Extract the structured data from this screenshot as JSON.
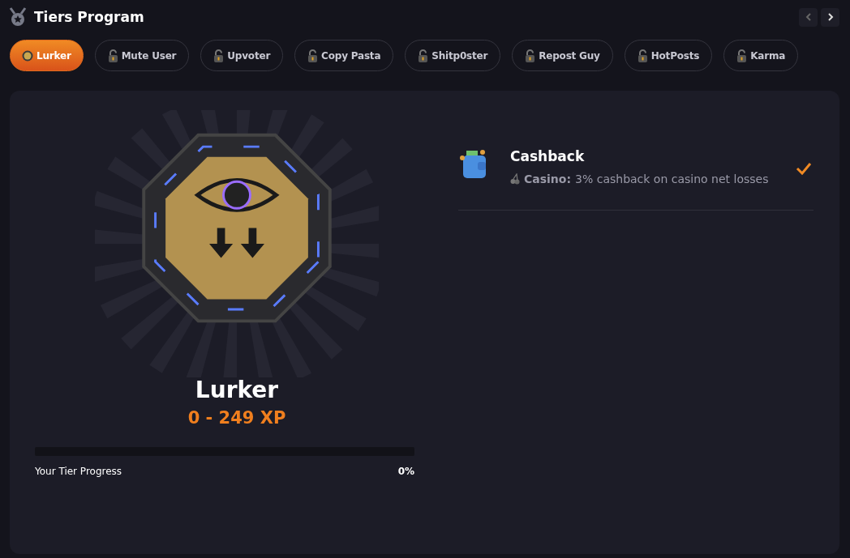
{
  "header": {
    "title": "Tiers Program"
  },
  "tabs": [
    {
      "label": "Lurker",
      "selected": true,
      "locked": false
    },
    {
      "label": "Mute User",
      "selected": false,
      "locked": true
    },
    {
      "label": "Upvoter",
      "selected": false,
      "locked": true
    },
    {
      "label": "Copy Pasta",
      "selected": false,
      "locked": true
    },
    {
      "label": "Shitp0ster",
      "selected": false,
      "locked": true
    },
    {
      "label": "Repost Guy",
      "selected": false,
      "locked": true
    },
    {
      "label": "HotPosts",
      "selected": false,
      "locked": true
    },
    {
      "label": "Karma",
      "selected": false,
      "locked": true
    }
  ],
  "tier": {
    "name": "Lurker",
    "xp_range": "0 - 249 XP",
    "progress": {
      "level": 0,
      "label": "Your Tier Progress",
      "reading": "0%"
    }
  },
  "rewards": [
    {
      "title": "Cashback",
      "category": "Casino:",
      "description": "3% cashback on casino net losses",
      "checked": true
    }
  ]
}
